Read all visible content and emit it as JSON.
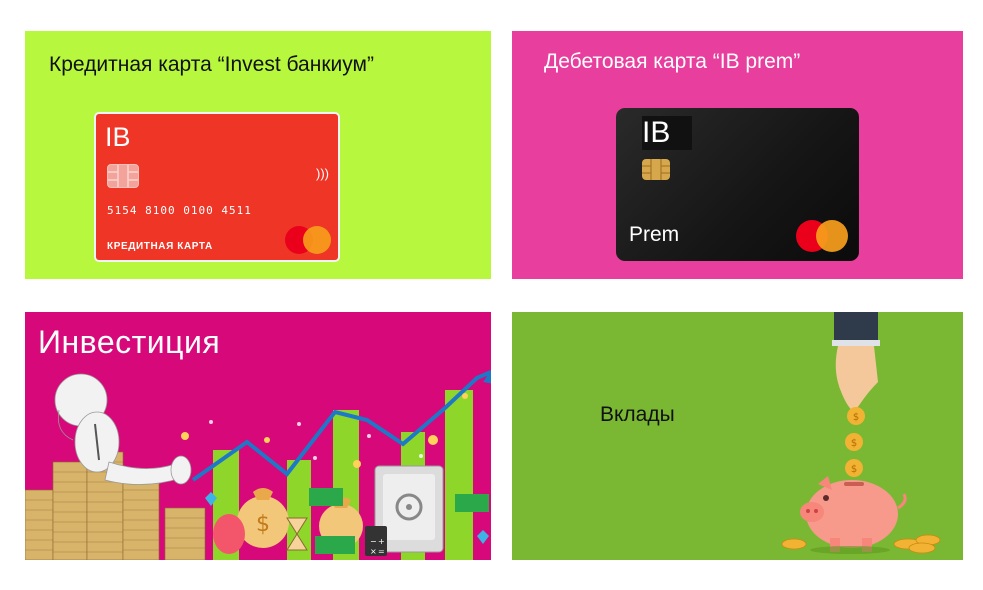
{
  "tiles": {
    "credit": {
      "title": "Кредитная карта “Invest банкиум”",
      "card": {
        "brand": "IB",
        "number": "5154  8100  0100  4511",
        "kind": "КРЕДИТНАЯ КАРТА",
        "contactless": ")))"
      },
      "background": "#b7f73e"
    },
    "debit": {
      "title": "Дебетовая карта “IB prem”",
      "card": {
        "brand": "IB",
        "label": "Prem"
      },
      "background": "#e83e9d"
    },
    "invest": {
      "title": "Инвестиция",
      "background": "#d6087a",
      "calculator_keys": [
        "−",
        "+",
        "×",
        "="
      ]
    },
    "deposit": {
      "title": "Вклады",
      "background": "#7ab833",
      "coin_symbol": "$"
    }
  },
  "colors": {
    "mastercard_red": "#eb001b",
    "mastercard_orange": "#f79e1b",
    "card_red": "#ee3526",
    "growth_bars": "#8fd62b",
    "trend_line": "#1e78c8"
  }
}
